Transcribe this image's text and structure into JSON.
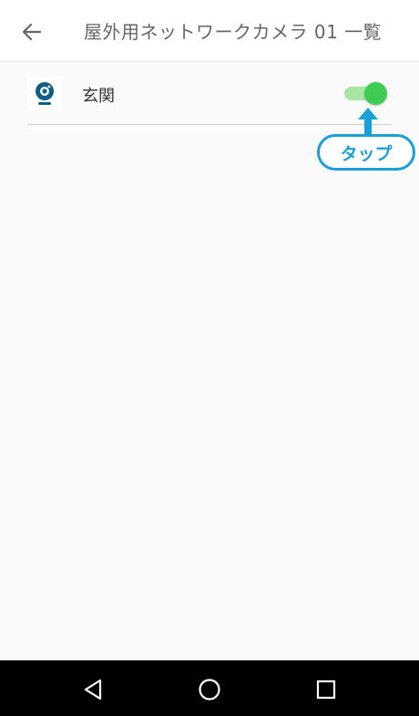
{
  "header": {
    "title": "屋外用ネットワークカメラ 01 一覧",
    "back_icon": "arrow-left-icon"
  },
  "list": {
    "items": [
      {
        "label": "玄関",
        "icon": "camera-icon",
        "toggle_on": true
      }
    ]
  },
  "annotation": {
    "label": "タップ",
    "color": "#1a9fd8"
  },
  "navbar": {
    "back_icon": "triangle-back-icon",
    "home_icon": "circle-home-icon",
    "recents_icon": "square-recents-icon"
  },
  "colors": {
    "toggle_thumb": "#3fcc55",
    "toggle_track": "#a7e6a2",
    "camera": "#0e5f86"
  }
}
